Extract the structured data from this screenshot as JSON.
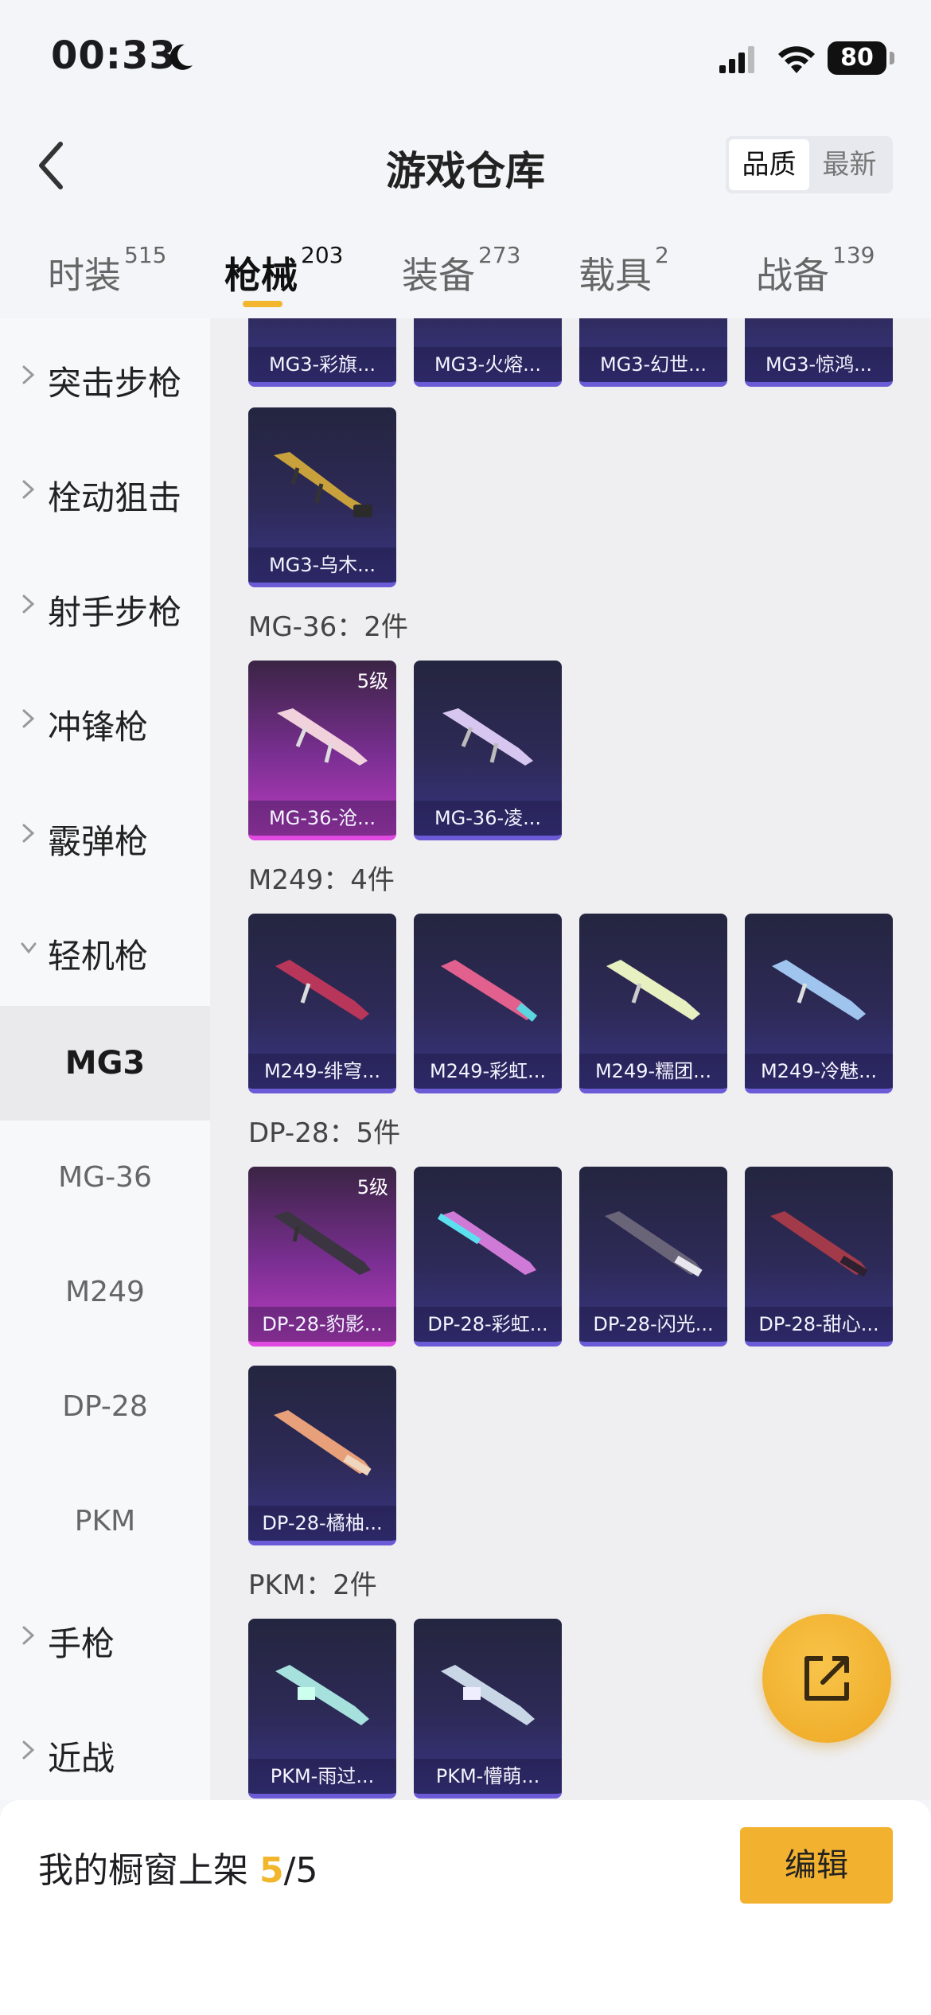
{
  "status_bar": {
    "time": "00:33",
    "battery": "80"
  },
  "header": {
    "title": "游戏仓库",
    "sort_quality": "品质",
    "sort_newest": "最新"
  },
  "tabs": [
    {
      "label": "时装",
      "count": "515"
    },
    {
      "label": "枪械",
      "count": "203"
    },
    {
      "label": "装备",
      "count": "273"
    },
    {
      "label": "载具",
      "count": "2"
    },
    {
      "label": "战备",
      "count": "139"
    }
  ],
  "sidebar": {
    "categories": [
      "突击步枪",
      "栓动狙击",
      "射手步枪",
      "冲锋枪",
      "霰弹枪",
      "轻机枪"
    ],
    "subcategories": [
      "MG3",
      "MG-36",
      "M249",
      "DP-28",
      "PKM"
    ],
    "bottom_categories": [
      "手枪",
      "近战"
    ]
  },
  "groups": {
    "mg3_items": [
      "MG3-彩旗...",
      "MG3-火熔...",
      "MG3-幻世...",
      "MG3-惊鸿...",
      "MG3-乌木..."
    ],
    "mg36_header": "MG-36：2件",
    "mg36_items": [
      "MG-36-沧...",
      "MG-36-凌..."
    ],
    "mg36_level": "5级",
    "m249_header": "M249：4件",
    "m249_items": [
      "M249-绯穹...",
      "M249-彩虹...",
      "M249-糯团...",
      "M249-冷魅..."
    ],
    "dp28_header": "DP-28：5件",
    "dp28_items": [
      "DP-28-豹影...",
      "DP-28-彩虹...",
      "DP-28-闪光...",
      "DP-28-甜心...",
      "DP-28-橘柚..."
    ],
    "dp28_level": "5级",
    "pkm_header": "PKM：2件",
    "pkm_items": [
      "PKM-雨过...",
      "PKM-懵萌..."
    ]
  },
  "bottom": {
    "shelf_label": "我的橱窗上架 ",
    "shelf_count": "5",
    "shelf_max": "/5",
    "edit_label": "编辑"
  },
  "colors": {
    "accent": "#f1b62c",
    "card_purple": "#3a3584",
    "card_magenta": "#bb3cc0"
  }
}
